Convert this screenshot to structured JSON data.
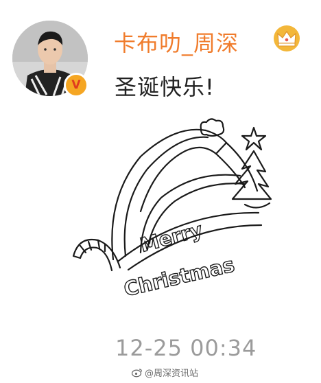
{
  "post": {
    "username": "卡布叻_周深",
    "verified_badge": "V",
    "crown_icon": "crown-icon",
    "text": "圣诞快乐!",
    "drawing_text_line1": "Merry",
    "drawing_text_line2": "Christmas",
    "timestamp": "12-25 00:34"
  },
  "watermark": {
    "text": "@周深资讯站",
    "icon": "weibo-logo-icon"
  },
  "colors": {
    "username": "#f07c2c",
    "timestamp": "#9b9b9b",
    "badge": "#f5a623"
  }
}
